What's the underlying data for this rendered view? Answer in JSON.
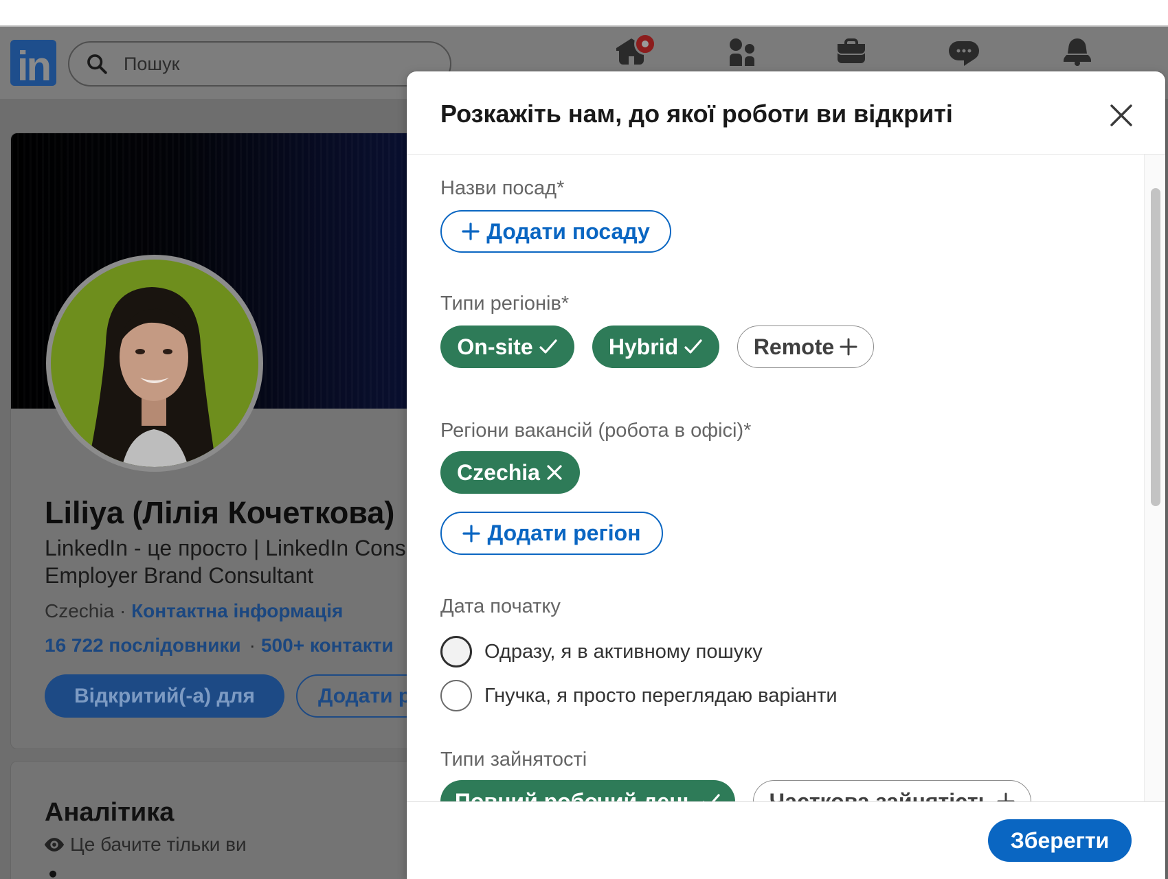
{
  "nav": {
    "logo_text": "in",
    "search_placeholder": "Пошук",
    "icons": [
      "search-icon",
      "home-icon",
      "my-network-icon",
      "jobs-icon",
      "messaging-icon",
      "notifications-icon"
    ],
    "home_has_badge": true
  },
  "profile": {
    "name": "Liliya (Лілія Кочеткова)",
    "headline_line1": "LinkedIn - це просто | LinkedIn Cons",
    "headline_line2": "Employer Brand Consultant",
    "location": "Czechia",
    "separator": "·",
    "contact_info_link": "Контактна інформація",
    "followers": "16 722 послідовники",
    "connections": "500+ контакти",
    "open_to_button": "Відкритий(-а) для",
    "add_section_button": "Додати р"
  },
  "analytics": {
    "title": "Аналітика",
    "visibility_note": "Це бачите тільки ви"
  },
  "modal": {
    "title": "Розкажіть нам, до якої роботи ви відкриті",
    "job_titles": {
      "label": "Назви посад*",
      "add_button": "Додати посаду"
    },
    "location_types": {
      "label": "Типи регіонів*",
      "chips": [
        {
          "label": "On-site",
          "selected": true
        },
        {
          "label": "Hybrid",
          "selected": true
        },
        {
          "label": "Remote",
          "selected": false
        }
      ]
    },
    "locations": {
      "label": "Регіони вакансій (робота в офісі)*",
      "chips": [
        {
          "label": "Czechia",
          "selected": true
        }
      ],
      "add_button": "Додати регіон"
    },
    "start_date": {
      "label": "Дата початку",
      "options": [
        {
          "label": "Одразу, я в активному пошуку",
          "checked": false
        },
        {
          "label": "Гнучка, я просто переглядаю варіанти",
          "checked": false
        }
      ]
    },
    "employment_types": {
      "label": "Типи зайнятості",
      "chips": [
        {
          "label": "Повний робочий день",
          "selected": true
        },
        {
          "label": "Часткова зайнятість",
          "selected": false
        }
      ]
    },
    "save_button": "Зберегти"
  },
  "colors": {
    "accent": "#0a66c2",
    "selected_chip": "#2e7b58",
    "notification_badge": "#8c1d1d"
  }
}
